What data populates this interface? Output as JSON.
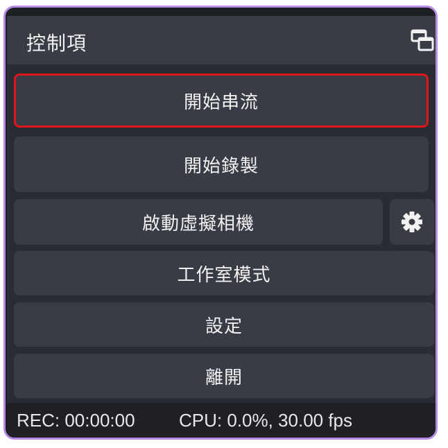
{
  "panel": {
    "title": "控制項",
    "undock_icon": "undock-icon"
  },
  "controls": {
    "start_streaming": "開始串流",
    "start_recording": "開始錄製",
    "start_virtual_camera": "啟動虛擬相機",
    "virtual_camera_settings_icon": "gear-icon",
    "studio_mode": "工作室模式",
    "settings": "設定",
    "exit": "離開"
  },
  "status": {
    "rec": "REC: 00:00:00",
    "cpu": "CPU: 0.0%, 30.00 fps"
  },
  "colors": {
    "frame_border": "#b98ae6",
    "panel_bg": "#2a2c33",
    "button_bg": "#3a3c45",
    "active_outline": "#e0141a",
    "text": "#f2f2f2"
  }
}
